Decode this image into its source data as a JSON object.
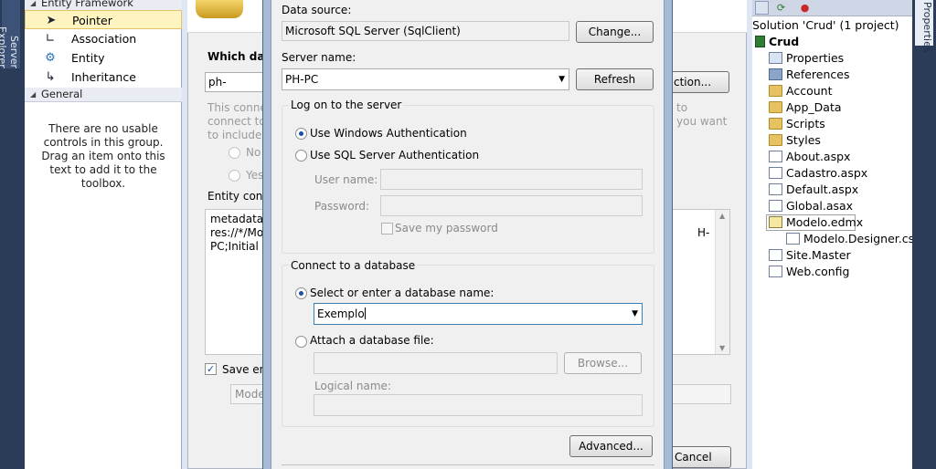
{
  "left_strip": {
    "tab_label": "Server Explorer"
  },
  "toolbox": {
    "section_entity": "Entity Framework",
    "items": [
      {
        "label": "Pointer",
        "icon": "pointer-icon"
      },
      {
        "label": "Association",
        "icon": "association-icon"
      },
      {
        "label": "Entity",
        "icon": "entity-icon"
      },
      {
        "label": "Inheritance",
        "icon": "inheritance-icon"
      }
    ],
    "section_general": "General",
    "empty_message": "There are no usable controls in this group. Drag an item onto this text to add it to the toolbox."
  },
  "wizard": {
    "question": "Which data",
    "connection_combo": "ph-pc.Exem",
    "new_connection_button": "ction...",
    "sensitive_text_left": [
      "This conne",
      "connect to",
      "to include t"
    ],
    "sensitive_text_right": [
      "to",
      "you want"
    ],
    "radio_no": "No",
    "radio_yes": "Yes",
    "entity_conn_label": "Entity conn",
    "conn_string_lines": [
      "metadata=",
      "res://*/Mo",
      "PC;Initial C"
    ],
    "conn_string_right": "H-",
    "save_label": "Save ent",
    "model_name_field": "Mode",
    "cancel_button": "Cancel"
  },
  "dialog": {
    "data_source_label": "Data source:",
    "data_source_value": "Microsoft SQL Server (SqlClient)",
    "change_button": "Change...",
    "server_name_label": "Server name:",
    "server_name_value": "PH-PC",
    "refresh_button": "Refresh",
    "logon_group_title": "Log on to the server",
    "windows_auth_label": "Use Windows Authentication",
    "sql_auth_label": "Use SQL Server Authentication",
    "username_label": "User name:",
    "password_label": "Password:",
    "save_password_label": "Save my password",
    "db_group_title": "Connect to a database",
    "select_db_label": "Select or enter a database name:",
    "db_name_value": "Exemplo",
    "attach_label": "Attach a database file:",
    "browse_button": "Browse...",
    "logical_name_label": "Logical name:",
    "advanced_button": "Advanced..."
  },
  "solution_explorer": {
    "solution_label": "Solution 'Crud' (1 project)",
    "project_label": "Crud",
    "items": [
      {
        "label": "Properties",
        "icon": "properties-icon"
      },
      {
        "label": "References",
        "icon": "references-icon"
      },
      {
        "label": "Account",
        "icon": "folder-icon"
      },
      {
        "label": "App_Data",
        "icon": "folder-icon"
      },
      {
        "label": "Scripts",
        "icon": "folder-icon"
      },
      {
        "label": "Styles",
        "icon": "folder-icon"
      },
      {
        "label": "About.aspx",
        "icon": "aspx-file-icon"
      },
      {
        "label": "Cadastro.aspx",
        "icon": "aspx-file-icon"
      },
      {
        "label": "Default.aspx",
        "icon": "aspx-file-icon"
      },
      {
        "label": "Global.asax",
        "icon": "asax-file-icon"
      },
      {
        "label": "Modelo.edmx",
        "icon": "edmx-file-icon"
      },
      {
        "label": "Modelo.Designer.cs",
        "icon": "cs-file-icon"
      },
      {
        "label": "Site.Master",
        "icon": "master-file-icon"
      },
      {
        "label": "Web.config",
        "icon": "config-file-icon"
      }
    ]
  },
  "right_strip": {
    "tab_label": "Properties"
  }
}
